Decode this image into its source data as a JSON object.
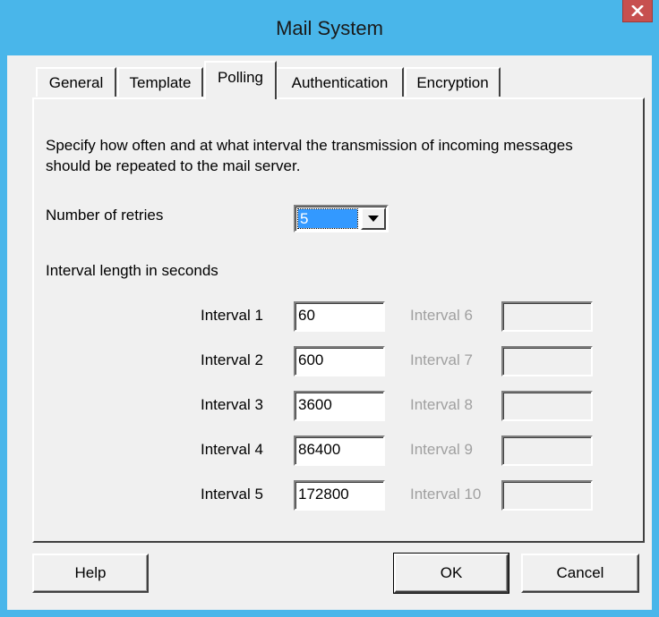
{
  "window": {
    "title": "Mail System",
    "close_icon": "close-icon"
  },
  "tabs": [
    {
      "label": "General",
      "active": false
    },
    {
      "label": "Template",
      "active": false
    },
    {
      "label": "Polling",
      "active": true
    },
    {
      "label": "Authentication",
      "active": false
    },
    {
      "label": "Encryption",
      "active": false
    }
  ],
  "polling": {
    "description": "Specify how often and at what interval the transmission of incoming messages should be repeated to the mail server.",
    "retries_label": "Number of retries",
    "retries_value": "5",
    "interval_heading": "Interval length in seconds",
    "intervals_left": [
      {
        "label": "Interval 1",
        "value": "60"
      },
      {
        "label": "Interval 2",
        "value": "600"
      },
      {
        "label": "Interval 3",
        "value": "3600"
      },
      {
        "label": "Interval 4",
        "value": "86400"
      },
      {
        "label": "Interval 5",
        "value": "172800"
      }
    ],
    "intervals_right": [
      {
        "label": "Interval 6",
        "value": ""
      },
      {
        "label": "Interval 7",
        "value": ""
      },
      {
        "label": "Interval 8",
        "value": ""
      },
      {
        "label": "Interval 9",
        "value": ""
      },
      {
        "label": "Interval 10",
        "value": ""
      }
    ]
  },
  "buttons": {
    "help": "Help",
    "ok": "OK",
    "cancel": "Cancel"
  },
  "colors": {
    "frame": "#49b6ea",
    "close_button": "#c7504f",
    "selection": "#3399ff",
    "disabled_text": "#a0a0a0"
  }
}
